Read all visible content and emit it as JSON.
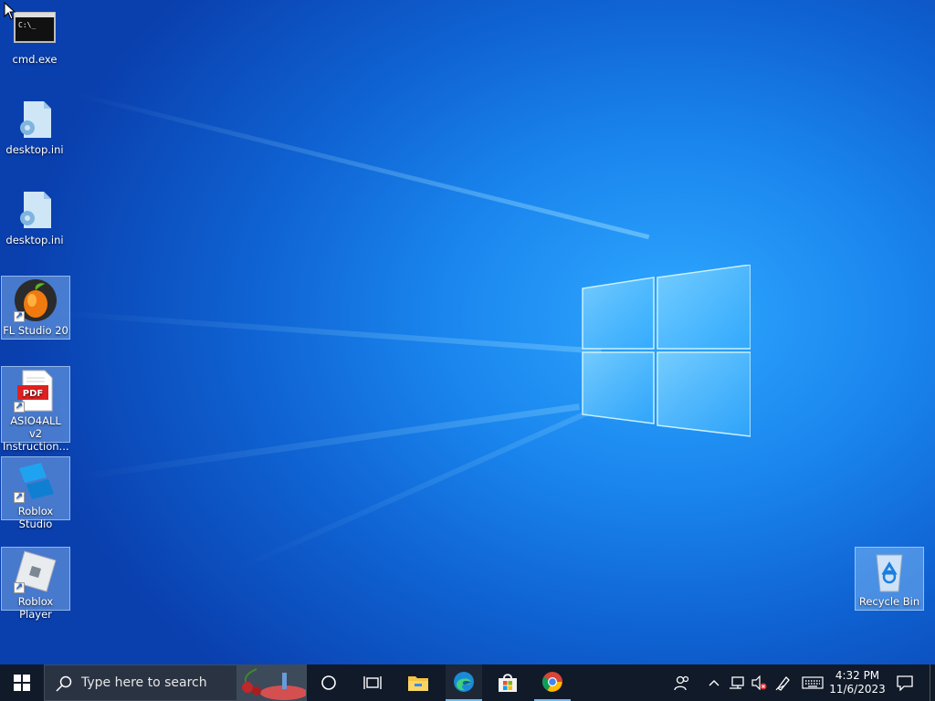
{
  "desktop": {
    "icons": [
      {
        "label": "cmd.exe",
        "icon": "cmd-icon"
      },
      {
        "label": "desktop.ini",
        "icon": "settings-file-icon"
      },
      {
        "label": "desktop.ini",
        "icon": "settings-file-icon"
      },
      {
        "label": "FL Studio 20",
        "icon": "fl-studio-icon"
      },
      {
        "label": "ASIO4ALL v2 Instruction...",
        "icon": "pdf-icon"
      },
      {
        "label": "Roblox Studio",
        "icon": "roblox-studio-icon"
      },
      {
        "label": "Roblox Player",
        "icon": "roblox-player-icon"
      },
      {
        "label": "Recycle Bin",
        "icon": "recycle-bin-icon"
      }
    ],
    "cmd_prompt_text": "C:\\_",
    "pdf_badge": "PDF"
  },
  "taskbar": {
    "search_placeholder": "Type here to search",
    "pinned": [
      "start-icon",
      "search-icon",
      "cortana-icon",
      "task-view-icon",
      "file-explorer-icon",
      "edge-icon",
      "store-icon",
      "chrome-icon"
    ],
    "clock_time": "4:32 PM",
    "clock_date": "11/6/2023",
    "tray": [
      "people-icon",
      "show-hidden-icons-chevron",
      "network-icon",
      "volume-muted-icon",
      "pen-icon",
      "keyboard-icon",
      "notifications-icon"
    ]
  },
  "colors": {
    "wallpaper_center": "#2fa7ff",
    "wallpaper_edge": "#0a3fae",
    "taskbar": "#101a29",
    "selection": "#aad7ff"
  }
}
